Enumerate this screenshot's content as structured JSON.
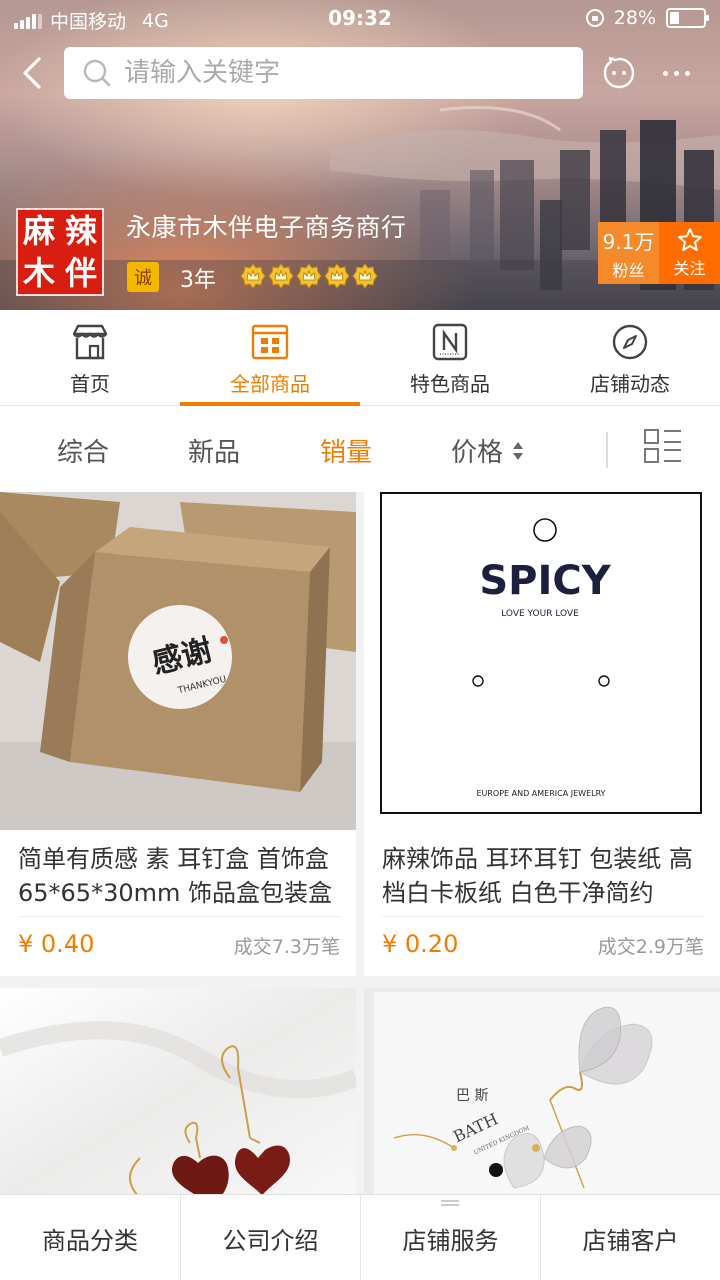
{
  "status_bar": {
    "carrier": "中国移动",
    "network": "4G",
    "time": "09:32",
    "battery": "28%",
    "battery_level": 0.28
  },
  "search": {
    "placeholder": "请输入关键字"
  },
  "shop": {
    "logo_chars": [
      "麻",
      "辣",
      "木",
      "伴"
    ],
    "name": "永康市木伴电子商务商行",
    "badge": "诚",
    "years": "3年",
    "crown_count": 5,
    "fans_count": "9.1万",
    "fans_label": "粉丝",
    "follow_label": "关注"
  },
  "nav_tabs": [
    {
      "label": "首页",
      "icon": "storefront-icon",
      "active": false
    },
    {
      "label": "全部商品",
      "icon": "grid-box-icon",
      "active": true
    },
    {
      "label": "特色商品",
      "icon": "new-badge-icon",
      "active": false
    },
    {
      "label": "店铺动态",
      "icon": "compass-icon",
      "active": false
    }
  ],
  "sort": {
    "items": [
      "综合",
      "新品",
      "销量",
      "价格"
    ],
    "active": "销量"
  },
  "products": [
    {
      "title": "简单有质感 素 耳钉盒 首饰盒65*65*30mm 饰品盒包装盒",
      "price": "¥ 0.40",
      "sold": "成交7.3万笔",
      "sticker_main": "感谢",
      "sticker_sub": "THANKYOU"
    },
    {
      "title": "麻辣饰品 耳环耳钉 包装纸 高档白卡板纸 白色干净简约",
      "price": "¥ 0.20",
      "sold": "成交2.9万笔",
      "card_brand": "SPICY",
      "card_tagline": "LOVE YOUR LOVE",
      "card_footer": "EUROPE AND AMERICA JEWELRY"
    },
    {
      "title": "",
      "price": "",
      "sold": ""
    },
    {
      "title": "",
      "price": "",
      "sold": "",
      "book_cn": "巴 斯",
      "book_en": "BATH",
      "book_sub": "UNITED KINGDOM"
    }
  ],
  "bottom_bar": [
    "商品分类",
    "公司介绍",
    "店铺服务",
    "店铺客户"
  ],
  "colors": {
    "accent": "#f07d00",
    "logo_red": "#d81e10",
    "follow_orange": "#ff6d00"
  }
}
